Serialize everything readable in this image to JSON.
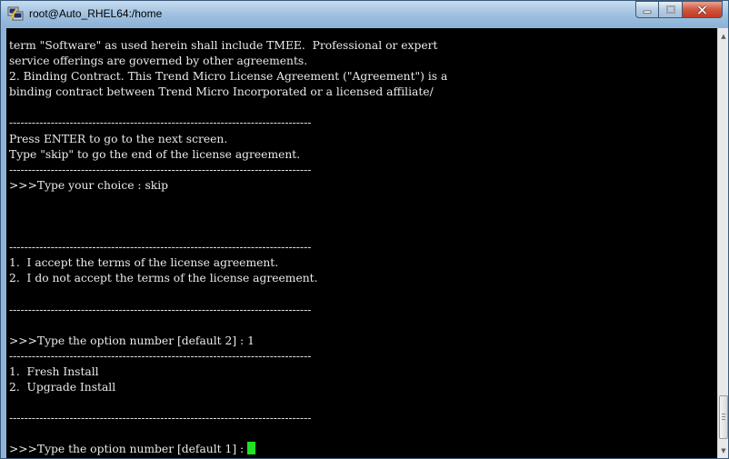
{
  "window": {
    "title": "root@Auto_RHEL64:/home",
    "app_icon": "putty-icon",
    "controls": [
      "minimize-icon",
      "maximize-icon",
      "close-icon"
    ]
  },
  "terminal": {
    "colors": {
      "background": "#000000",
      "text": "#eaeaea",
      "cursor": "#20e020"
    },
    "lines": [
      "term \"Software\" as used herein shall include TMEE.  Professional or expert",
      "service offerings are governed by other agreements.",
      "2. Binding Contract. This Trend Micro License Agreement (\"Agreement\") is a",
      "binding contract between Trend Micro Incorporated or a licensed affiliate/",
      "",
      "--------------------------------------------------------------------------------",
      "Press ENTER to go to the next screen.",
      "Type \"skip\" to go the end of the license agreement.",
      "--------------------------------------------------------------------------------",
      ">>>Type your choice : skip",
      "",
      "",
      "",
      "--------------------------------------------------------------------------------",
      "1.  I accept the terms of the license agreement.",
      "2.  I do not accept the terms of the license agreement.",
      "",
      "--------------------------------------------------------------------------------",
      "",
      ">>>Type the option number [default 2] : 1",
      "--------------------------------------------------------------------------------",
      "1.  Fresh Install",
      "2.  Upgrade Install",
      "",
      "--------------------------------------------------------------------------------",
      "",
      ">>>Type the option number [default 1] : "
    ]
  },
  "scrollbar": {
    "up": "arrow-up-icon",
    "down": "arrow-down-icon",
    "position": 0.92
  }
}
